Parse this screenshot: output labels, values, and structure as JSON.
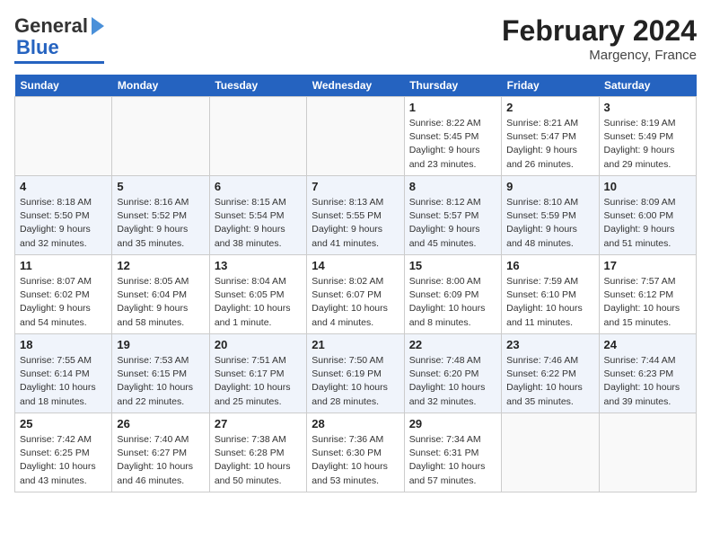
{
  "header": {
    "logo_line1": "General",
    "logo_line2": "Blue",
    "title": "February 2024",
    "location": "Margency, France"
  },
  "days_of_week": [
    "Sunday",
    "Monday",
    "Tuesday",
    "Wednesday",
    "Thursday",
    "Friday",
    "Saturday"
  ],
  "weeks": [
    [
      {
        "day": "",
        "info": ""
      },
      {
        "day": "",
        "info": ""
      },
      {
        "day": "",
        "info": ""
      },
      {
        "day": "",
        "info": ""
      },
      {
        "day": "1",
        "info": "Sunrise: 8:22 AM\nSunset: 5:45 PM\nDaylight: 9 hours\nand 23 minutes."
      },
      {
        "day": "2",
        "info": "Sunrise: 8:21 AM\nSunset: 5:47 PM\nDaylight: 9 hours\nand 26 minutes."
      },
      {
        "day": "3",
        "info": "Sunrise: 8:19 AM\nSunset: 5:49 PM\nDaylight: 9 hours\nand 29 minutes."
      }
    ],
    [
      {
        "day": "4",
        "info": "Sunrise: 8:18 AM\nSunset: 5:50 PM\nDaylight: 9 hours\nand 32 minutes."
      },
      {
        "day": "5",
        "info": "Sunrise: 8:16 AM\nSunset: 5:52 PM\nDaylight: 9 hours\nand 35 minutes."
      },
      {
        "day": "6",
        "info": "Sunrise: 8:15 AM\nSunset: 5:54 PM\nDaylight: 9 hours\nand 38 minutes."
      },
      {
        "day": "7",
        "info": "Sunrise: 8:13 AM\nSunset: 5:55 PM\nDaylight: 9 hours\nand 41 minutes."
      },
      {
        "day": "8",
        "info": "Sunrise: 8:12 AM\nSunset: 5:57 PM\nDaylight: 9 hours\nand 45 minutes."
      },
      {
        "day": "9",
        "info": "Sunrise: 8:10 AM\nSunset: 5:59 PM\nDaylight: 9 hours\nand 48 minutes."
      },
      {
        "day": "10",
        "info": "Sunrise: 8:09 AM\nSunset: 6:00 PM\nDaylight: 9 hours\nand 51 minutes."
      }
    ],
    [
      {
        "day": "11",
        "info": "Sunrise: 8:07 AM\nSunset: 6:02 PM\nDaylight: 9 hours\nand 54 minutes."
      },
      {
        "day": "12",
        "info": "Sunrise: 8:05 AM\nSunset: 6:04 PM\nDaylight: 9 hours\nand 58 minutes."
      },
      {
        "day": "13",
        "info": "Sunrise: 8:04 AM\nSunset: 6:05 PM\nDaylight: 10 hours\nand 1 minute."
      },
      {
        "day": "14",
        "info": "Sunrise: 8:02 AM\nSunset: 6:07 PM\nDaylight: 10 hours\nand 4 minutes."
      },
      {
        "day": "15",
        "info": "Sunrise: 8:00 AM\nSunset: 6:09 PM\nDaylight: 10 hours\nand 8 minutes."
      },
      {
        "day": "16",
        "info": "Sunrise: 7:59 AM\nSunset: 6:10 PM\nDaylight: 10 hours\nand 11 minutes."
      },
      {
        "day": "17",
        "info": "Sunrise: 7:57 AM\nSunset: 6:12 PM\nDaylight: 10 hours\nand 15 minutes."
      }
    ],
    [
      {
        "day": "18",
        "info": "Sunrise: 7:55 AM\nSunset: 6:14 PM\nDaylight: 10 hours\nand 18 minutes."
      },
      {
        "day": "19",
        "info": "Sunrise: 7:53 AM\nSunset: 6:15 PM\nDaylight: 10 hours\nand 22 minutes."
      },
      {
        "day": "20",
        "info": "Sunrise: 7:51 AM\nSunset: 6:17 PM\nDaylight: 10 hours\nand 25 minutes."
      },
      {
        "day": "21",
        "info": "Sunrise: 7:50 AM\nSunset: 6:19 PM\nDaylight: 10 hours\nand 28 minutes."
      },
      {
        "day": "22",
        "info": "Sunrise: 7:48 AM\nSunset: 6:20 PM\nDaylight: 10 hours\nand 32 minutes."
      },
      {
        "day": "23",
        "info": "Sunrise: 7:46 AM\nSunset: 6:22 PM\nDaylight: 10 hours\nand 35 minutes."
      },
      {
        "day": "24",
        "info": "Sunrise: 7:44 AM\nSunset: 6:23 PM\nDaylight: 10 hours\nand 39 minutes."
      }
    ],
    [
      {
        "day": "25",
        "info": "Sunrise: 7:42 AM\nSunset: 6:25 PM\nDaylight: 10 hours\nand 43 minutes."
      },
      {
        "day": "26",
        "info": "Sunrise: 7:40 AM\nSunset: 6:27 PM\nDaylight: 10 hours\nand 46 minutes."
      },
      {
        "day": "27",
        "info": "Sunrise: 7:38 AM\nSunset: 6:28 PM\nDaylight: 10 hours\nand 50 minutes."
      },
      {
        "day": "28",
        "info": "Sunrise: 7:36 AM\nSunset: 6:30 PM\nDaylight: 10 hours\nand 53 minutes."
      },
      {
        "day": "29",
        "info": "Sunrise: 7:34 AM\nSunset: 6:31 PM\nDaylight: 10 hours\nand 57 minutes."
      },
      {
        "day": "",
        "info": ""
      },
      {
        "day": "",
        "info": ""
      }
    ]
  ]
}
